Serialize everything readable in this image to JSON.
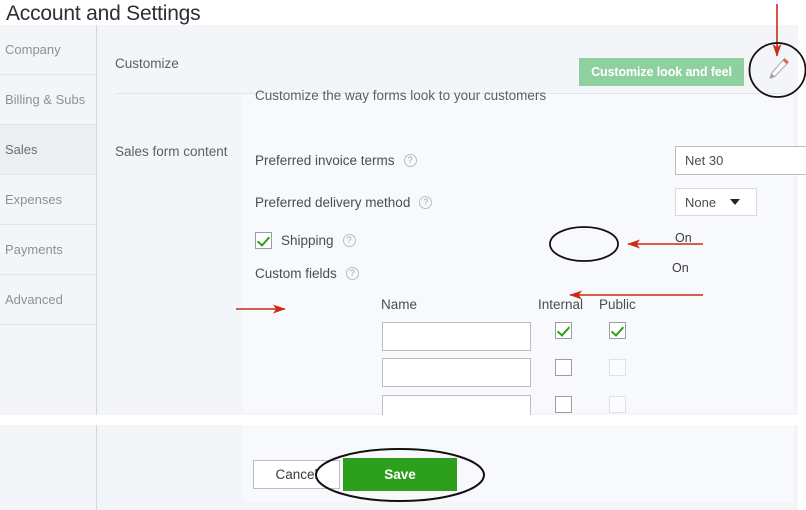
{
  "page": {
    "title": "Account and Settings"
  },
  "sidebar": {
    "items": [
      {
        "label": "Company",
        "active": false
      },
      {
        "label": "Billing & Subs",
        "active": false
      },
      {
        "label": "Sales",
        "active": true
      },
      {
        "label": "Expenses",
        "active": false
      },
      {
        "label": "Payments",
        "active": false
      },
      {
        "label": "Advanced",
        "active": false
      }
    ]
  },
  "sections": {
    "customize": {
      "label": "Customize",
      "description": "Customize the way forms look to your customers",
      "button_label": "Customize look and feel",
      "button_color": "#8fd19e",
      "edit_icon": "pencil-icon"
    },
    "sales_form_content": {
      "label": "Sales form content",
      "preferred_invoice_terms": {
        "label": "Preferred invoice terms",
        "value": "Net 30",
        "help_icon": "question-mark-icon"
      },
      "preferred_delivery_method": {
        "label": "Preferred delivery method",
        "value": "None",
        "help_icon": "question-mark-icon"
      },
      "shipping": {
        "label": "Shipping",
        "checked": true,
        "help_icon": "question-mark-icon"
      },
      "custom_fields": {
        "label": "Custom fields",
        "help_icon": "question-mark-icon",
        "toggle_status_top": "On",
        "toggle_status_circled": "On",
        "columns": [
          "Name",
          "Internal",
          "Public"
        ],
        "rows": [
          {
            "name": "",
            "internal": true,
            "public": true,
            "public_disabled": false
          },
          {
            "name": "",
            "internal": false,
            "public": false,
            "public_disabled": true
          },
          {
            "name": "",
            "internal": false,
            "public": false,
            "public_disabled": true
          }
        ]
      }
    }
  },
  "footer": {
    "cancel_label": "Cancel",
    "save_label": "Save",
    "save_color": "#2ca01c"
  },
  "annotations": {
    "accent_color": "#cc2b16",
    "circle_color": "#000000",
    "marks": [
      {
        "name": "arrow-to-pencil-icon",
        "type": "arrow-down"
      },
      {
        "name": "circle-around-pencil-icon",
        "type": "circle"
      },
      {
        "name": "arrow-to-custom-fields-toggle",
        "type": "arrow-left"
      },
      {
        "name": "circle-around-custom-fields-toggle",
        "type": "ellipse"
      },
      {
        "name": "arrow-to-public-checkbox",
        "type": "arrow-left"
      },
      {
        "name": "arrow-to-name-input",
        "type": "arrow-right"
      },
      {
        "name": "circle-around-save-button",
        "type": "ellipse"
      }
    ]
  }
}
